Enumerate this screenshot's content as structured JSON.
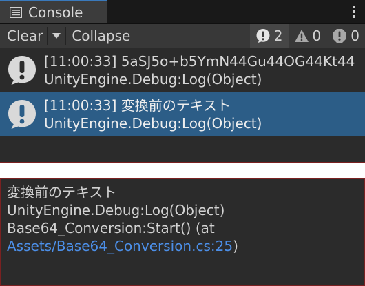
{
  "tab": {
    "icon": "console-list-icon",
    "label": "Console"
  },
  "toolbar": {
    "clear_label": "Clear",
    "collapse_label": "Collapse",
    "counters": {
      "info": "2",
      "warning": "0",
      "error": "0"
    }
  },
  "entries": [
    {
      "line1": "[11:00:33] 5aSJ5o+b5YmN44Gu44OG44Kt44",
      "line2": "UnityEngine.Debug:Log(Object)",
      "selected": false
    },
    {
      "line1": "[11:00:33] 変換前のテキスト",
      "line2": "UnityEngine.Debug:Log(Object)",
      "selected": true
    }
  ],
  "detail": {
    "line1": "変換前のテキスト",
    "line2": "UnityEngine.Debug:Log(Object)",
    "line3": "Base64_Conversion:Start() (at",
    "link": "Assets/Base64_Conversion.cs:25",
    "link_suffix": ")"
  },
  "colors": {
    "accent": "#3a79bb",
    "selection": "#2c5d87",
    "link": "#4c8fe8",
    "highlight_border": "#7a2121"
  }
}
